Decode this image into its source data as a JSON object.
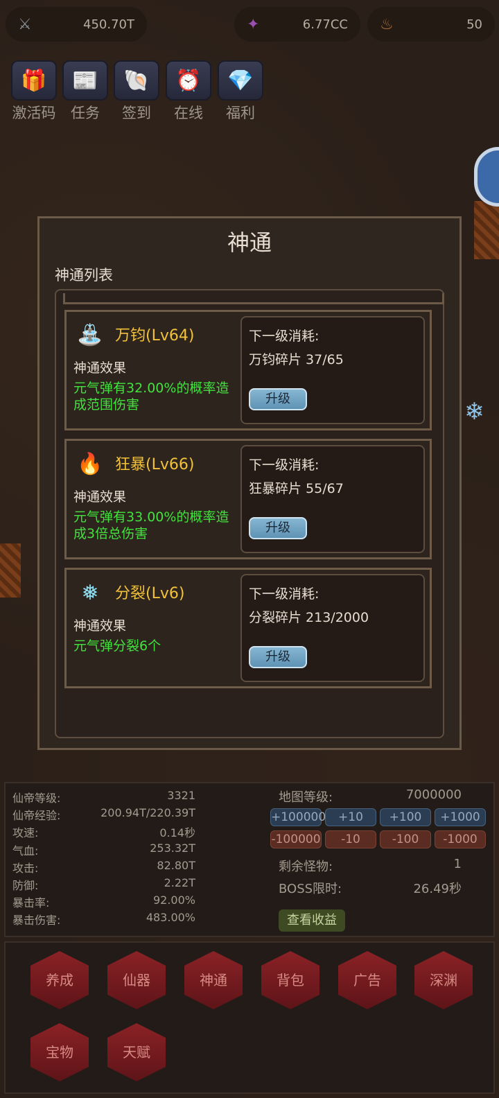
{
  "resources": {
    "power": {
      "icon": "crossed-swords-icon",
      "value": "450.70T"
    },
    "gem": {
      "icon": "purple-crystal-icon",
      "value": "6.77CC"
    },
    "token": {
      "icon": "fire-spirit-icon",
      "value": "50"
    }
  },
  "top_buttons": [
    {
      "icon": "gift-icon",
      "label": "激活码"
    },
    {
      "icon": "newspaper-icon",
      "label": "任务"
    },
    {
      "icon": "shell-icon",
      "label": "签到"
    },
    {
      "icon": "alarm-clock-icon",
      "label": "在线"
    },
    {
      "icon": "crystal-icon",
      "label": "福利"
    }
  ],
  "panel": {
    "title": "神通",
    "subtitle": "神通列表",
    "cards": [
      {
        "icon": "water-spout-icon",
        "name": "万钧(Lv64)",
        "effect_label": "神通效果",
        "effect": "元气弹有32.00%的概率造成范围伤害",
        "cost_label": "下一级消耗:",
        "cost_value": "万钧碎片 37/65",
        "button": "升级"
      },
      {
        "icon": "torch-icon",
        "name": "狂暴(Lv66)",
        "effect_label": "神通效果",
        "effect": "元气弹有33.00%的概率造成3倍总伤害",
        "cost_label": "下一级消耗:",
        "cost_value": "狂暴碎片 55/67",
        "button": "升级"
      },
      {
        "icon": "ice-shards-icon",
        "name": "分裂(Lv6)",
        "effect_label": "神通效果",
        "effect": "元气弹分裂6个",
        "cost_label": "下一级消耗:",
        "cost_value": "分裂碎片 213/2000",
        "button": "升级"
      }
    ]
  },
  "stats": {
    "left": [
      {
        "label": "仙帝等级:",
        "value": "3321"
      },
      {
        "label": "仙帝经验:",
        "value": "200.94T/220.39T"
      },
      {
        "label": "攻速:",
        "value": "0.14秒"
      },
      {
        "label": "气血:",
        "value": "253.32T"
      },
      {
        "label": "攻击:",
        "value": "82.80T"
      },
      {
        "label": "防御:",
        "value": "2.22T"
      },
      {
        "label": "暴击率:",
        "value": "92.00%"
      },
      {
        "label": "暴击伤害:",
        "value": "483.00%"
      }
    ],
    "map_level_label": "地图等级:",
    "map_level": "7000000",
    "plus_buttons": [
      "+100000",
      "+10",
      "+100",
      "+1000"
    ],
    "minus_buttons": [
      "-100000",
      "-10",
      "-100",
      "-1000"
    ],
    "monsters_label": "剩余怪物:",
    "monsters": "1",
    "boss_label": "BOSS限时:",
    "boss_time": "26.49秒",
    "view_button": "查看收益"
  },
  "nav": [
    "养成",
    "仙器",
    "神通",
    "背包",
    "广告",
    "深渊",
    "宝物",
    "天赋"
  ]
}
